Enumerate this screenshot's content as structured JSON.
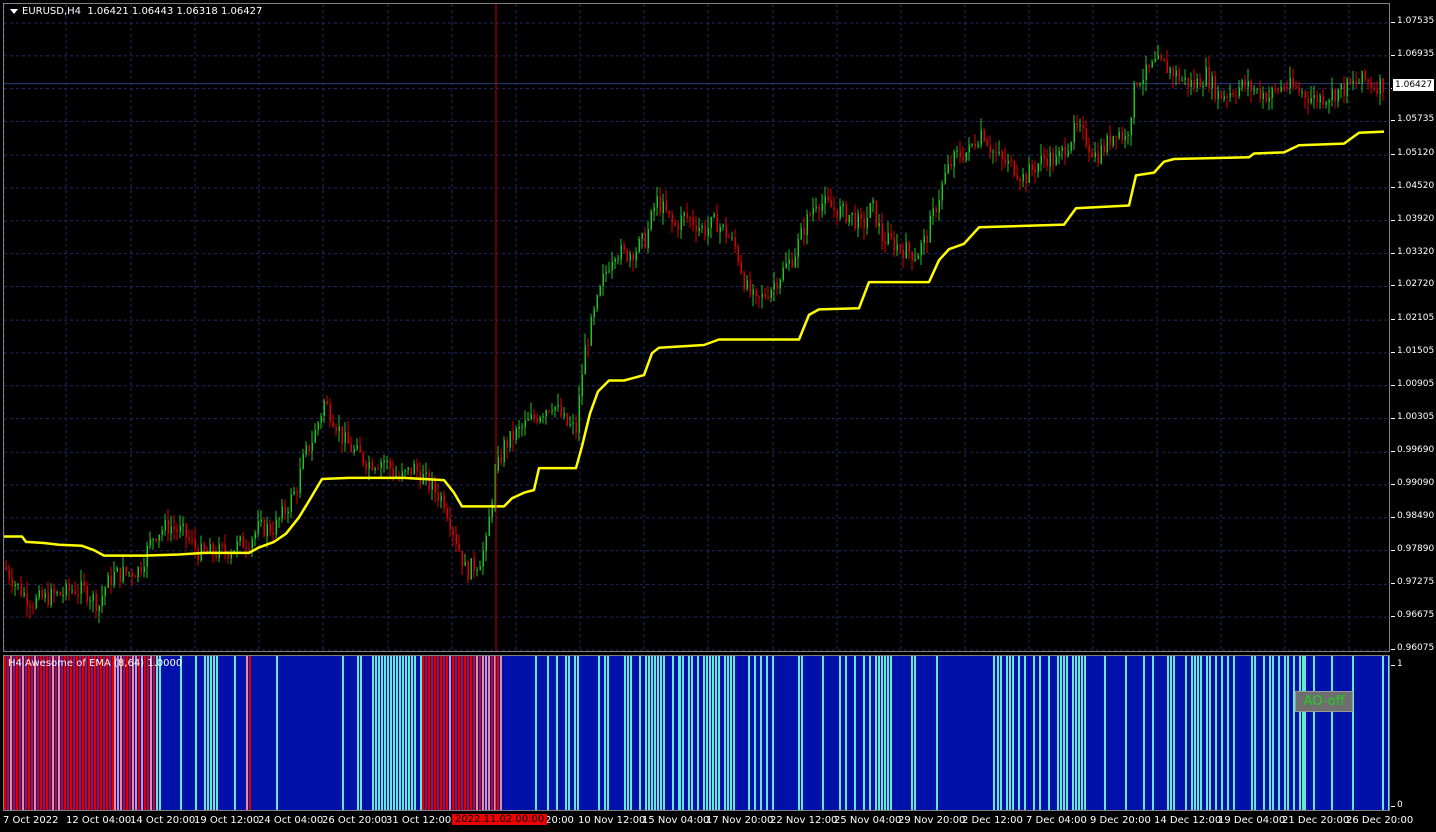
{
  "chart_header": {
    "symbol": "EURUSD,H4",
    "ohlc": "1.06421 1.06443 1.06318 1.06427"
  },
  "indicator_header": "H4 Awesome of EMA (8,64) 1.0000",
  "price_axis": [
    "1.07535",
    "1.06935",
    "1.06335",
    "1.05735",
    "1.05120",
    "1.04520",
    "1.03920",
    "1.03320",
    "1.02720",
    "1.02105",
    "1.01505",
    "1.00905",
    "1.00305",
    "0.99690",
    "0.99090",
    "0.98490",
    "0.97890",
    "0.97275",
    "0.96675",
    "0.96075"
  ],
  "current_price": "1.06427",
  "indicator_axis": [
    "1",
    "0"
  ],
  "date_axis": [
    "7 Oct 2022",
    "12 Oct 04:00",
    "14 Oct 20:00",
    "19 Oct 12:00",
    "24 Oct 04:00",
    "26 Oct 20:00",
    "31 Oct 12:00",
    "v 20:00",
    "10 Nov 12:00",
    "15 Nov 04:00",
    "17 Nov 20:00",
    "22 Nov 12:00",
    "25 Nov 04:00",
    "29 Nov 20:00",
    "2 Dec 12:00",
    "7 Dec 04:00",
    "9 Dec 20:00",
    "14 Dec 12:00",
    "19 Dec 04:00",
    "21 Dec 20:00",
    "26 Dec 20:00"
  ],
  "crosshair_date": "2022.11.02 00:00",
  "ao_button": "AO-off",
  "colors": {
    "bull": "#21c521",
    "bear": "#e00000",
    "ma": "#ffff00",
    "grid": "#1e2a66",
    "ao_blue": "#0011aa",
    "ao_cyan": "#66e6d4",
    "ao_red": "#e00000",
    "ao_pink": "#e08fa8",
    "crosshair": "#c00000"
  },
  "chart_data": {
    "type": "candlestick",
    "timeframe": "H4",
    "ylim": [
      0.96075,
      1.07535
    ],
    "price_path": [
      [
        0,
        0.976
      ],
      [
        15,
        0.972
      ],
      [
        28,
        0.9695
      ],
      [
        45,
        0.9705
      ],
      [
        58,
        0.971
      ],
      [
        70,
        0.972
      ],
      [
        82,
        0.9715
      ],
      [
        95,
        0.969
      ],
      [
        100,
        0.972
      ],
      [
        110,
        0.9745
      ],
      [
        125,
        0.975
      ],
      [
        135,
        0.9755
      ],
      [
        150,
        0.982
      ],
      [
        165,
        0.9835
      ],
      [
        180,
        0.982
      ],
      [
        195,
        0.9785
      ],
      [
        210,
        0.9785
      ],
      [
        225,
        0.979
      ],
      [
        245,
        0.981
      ],
      [
        255,
        0.983
      ],
      [
        270,
        0.983
      ],
      [
        280,
        0.986
      ],
      [
        292,
        0.99
      ],
      [
        300,
        0.996
      ],
      [
        310,
        1.0
      ],
      [
        320,
        1.006
      ],
      [
        330,
        1.003
      ],
      [
        340,
        0.999
      ],
      [
        350,
        0.997
      ],
      [
        365,
        0.995
      ],
      [
        380,
        0.9955
      ],
      [
        395,
        0.992
      ],
      [
        410,
        0.994
      ],
      [
        425,
        0.991
      ],
      [
        440,
        0.988
      ],
      [
        452,
        0.981
      ],
      [
        462,
        0.975
      ],
      [
        475,
        0.977
      ],
      [
        482,
        0.98
      ],
      [
        490,
        0.992
      ],
      [
        500,
        0.998
      ],
      [
        510,
        1.0
      ],
      [
        522,
        1.002
      ],
      [
        535,
        1.004
      ],
      [
        548,
        1.006
      ],
      [
        562,
        1.002
      ],
      [
        572,
        1.001
      ],
      [
        580,
        1.015
      ],
      [
        590,
        1.022
      ],
      [
        600,
        1.029
      ],
      [
        610,
        1.034
      ],
      [
        620,
        1.033
      ],
      [
        632,
        1.034
      ],
      [
        642,
        1.036
      ],
      [
        652,
        1.043
      ],
      [
        660,
        1.041
      ],
      [
        670,
        1.038
      ],
      [
        680,
        1.04
      ],
      [
        690,
        1.039
      ],
      [
        700,
        1.0375
      ],
      [
        712,
        1.039
      ],
      [
        722,
        1.037
      ],
      [
        732,
        1.034
      ],
      [
        742,
        1.027
      ],
      [
        752,
        1.024
      ],
      [
        762,
        1.026
      ],
      [
        775,
        1.029
      ],
      [
        790,
        1.033
      ],
      [
        800,
        1.038
      ],
      [
        812,
        1.043
      ],
      [
        822,
        1.042
      ],
      [
        835,
        1.041
      ],
      [
        848,
        1.04
      ],
      [
        858,
        1.038
      ],
      [
        868,
        1.042
      ],
      [
        878,
        1.036
      ],
      [
        890,
        1.035
      ],
      [
        900,
        1.034
      ],
      [
        912,
        1.033
      ],
      [
        922,
        1.036
      ],
      [
        932,
        1.042
      ],
      [
        942,
        1.048
      ],
      [
        952,
        1.051
      ],
      [
        965,
        1.052
      ],
      [
        978,
        1.056
      ],
      [
        988,
        1.052
      ],
      [
        998,
        1.05
      ],
      [
        1010,
        1.049
      ],
      [
        1020,
        1.047
      ],
      [
        1030,
        1.049
      ],
      [
        1042,
        1.051
      ],
      [
        1052,
        1.05
      ],
      [
        1062,
        1.053
      ],
      [
        1072,
        1.056
      ],
      [
        1082,
        1.054
      ],
      [
        1092,
        1.051
      ],
      [
        1102,
        1.053
      ],
      [
        1112,
        1.056
      ],
      [
        1122,
        1.054
      ],
      [
        1132,
        1.065
      ],
      [
        1142,
        1.066
      ],
      [
        1152,
        1.068
      ],
      [
        1165,
        1.067
      ],
      [
        1178,
        1.065
      ],
      [
        1190,
        1.064
      ],
      [
        1202,
        1.066
      ],
      [
        1215,
        1.062
      ],
      [
        1228,
        1.063
      ],
      [
        1240,
        1.064
      ],
      [
        1252,
        1.063
      ],
      [
        1265,
        1.062
      ],
      [
        1280,
        1.064
      ],
      [
        1295,
        1.063
      ],
      [
        1310,
        1.0615
      ],
      [
        1322,
        1.062
      ],
      [
        1335,
        1.063
      ],
      [
        1348,
        1.064
      ],
      [
        1360,
        1.065
      ],
      [
        1370,
        1.064
      ],
      [
        1378,
        1.0643
      ]
    ],
    "ma_line": [
      [
        0,
        0.9815
      ],
      [
        18,
        0.9815
      ],
      [
        22,
        0.9805
      ],
      [
        40,
        0.9803
      ],
      [
        55,
        0.98
      ],
      [
        78,
        0.9798
      ],
      [
        90,
        0.979
      ],
      [
        100,
        0.978
      ],
      [
        140,
        0.978
      ],
      [
        175,
        0.9782
      ],
      [
        200,
        0.9785
      ],
      [
        245,
        0.9785
      ],
      [
        255,
        0.9795
      ],
      [
        270,
        0.9805
      ],
      [
        282,
        0.982
      ],
      [
        295,
        0.985
      ],
      [
        305,
        0.988
      ],
      [
        318,
        0.992
      ],
      [
        345,
        0.9922
      ],
      [
        400,
        0.9922
      ],
      [
        440,
        0.9918
      ],
      [
        450,
        0.9895
      ],
      [
        458,
        0.987
      ],
      [
        500,
        0.987
      ],
      [
        508,
        0.9885
      ],
      [
        520,
        0.9895
      ],
      [
        530,
        0.99
      ],
      [
        535,
        0.994
      ],
      [
        572,
        0.994
      ],
      [
        578,
        0.998
      ],
      [
        586,
        1.004
      ],
      [
        594,
        1.008
      ],
      [
        605,
        1.01
      ],
      [
        620,
        1.01
      ],
      [
        640,
        1.011
      ],
      [
        648,
        1.015
      ],
      [
        655,
        1.016
      ],
      [
        700,
        1.0165
      ],
      [
        715,
        1.0175
      ],
      [
        795,
        1.0175
      ],
      [
        805,
        1.022
      ],
      [
        815,
        1.023
      ],
      [
        855,
        1.0232
      ],
      [
        865,
        1.028
      ],
      [
        925,
        1.028
      ],
      [
        935,
        1.032
      ],
      [
        945,
        1.034
      ],
      [
        960,
        1.035
      ],
      [
        975,
        1.038
      ],
      [
        1060,
        1.0385
      ],
      [
        1072,
        1.0415
      ],
      [
        1125,
        1.042
      ],
      [
        1132,
        1.0475
      ],
      [
        1150,
        1.048
      ],
      [
        1160,
        1.05
      ],
      [
        1170,
        1.0505
      ],
      [
        1245,
        1.0508
      ],
      [
        1250,
        1.0515
      ],
      [
        1280,
        1.0517
      ],
      [
        1295,
        1.053
      ],
      [
        1340,
        1.0533
      ],
      [
        1355,
        1.0553
      ],
      [
        1380,
        1.0555
      ]
    ],
    "indicator": {
      "name": "Awesome of EMA (8,64)",
      "ylim": [
        0,
        1
      ],
      "segments": [
        [
          0,
          110,
          "red"
        ],
        [
          110,
          152,
          "mixed_red"
        ],
        [
          152,
          188,
          "blue"
        ],
        [
          188,
          242,
          "cyan_mix"
        ],
        [
          242,
          248,
          "red"
        ],
        [
          248,
          338,
          "blue"
        ],
        [
          338,
          418,
          "cyan"
        ],
        [
          418,
          430,
          "red"
        ],
        [
          430,
          478,
          "red"
        ],
        [
          478,
          498,
          "pink"
        ],
        [
          498,
          540,
          "blue"
        ],
        [
          540,
          585,
          "cyan_mix"
        ],
        [
          585,
          620,
          "blue"
        ],
        [
          620,
          675,
          "cyan_mix"
        ],
        [
          675,
          770,
          "cyan"
        ],
        [
          770,
          835,
          "blue"
        ],
        [
          835,
          920,
          "cyan_mix"
        ],
        [
          920,
          990,
          "blue"
        ],
        [
          990,
          1085,
          "cyan"
        ],
        [
          1085,
          1160,
          "blue"
        ],
        [
          1160,
          1300,
          "cyan"
        ],
        [
          1300,
          1387,
          "mixed_end"
        ]
      ]
    }
  }
}
